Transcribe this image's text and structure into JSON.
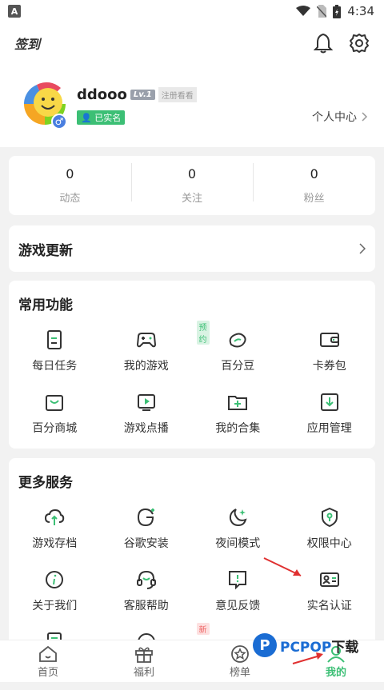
{
  "statusbar": {
    "app_badge": "A",
    "time": "4:34"
  },
  "topbar": {
    "signin_label": "签到"
  },
  "profile": {
    "username": "ddooo",
    "level": "Lv.1",
    "level_tag": "注册看看",
    "verified": "已实名",
    "center_link": "个人中心"
  },
  "stats": [
    {
      "value": "0",
      "label": "动态"
    },
    {
      "value": "0",
      "label": "关注"
    },
    {
      "value": "0",
      "label": "粉丝"
    }
  ],
  "game_update": {
    "title": "游戏更新"
  },
  "common": {
    "title": "常用功能",
    "items": [
      {
        "label": "每日任务",
        "icon": "task-icon"
      },
      {
        "label": "我的游戏",
        "icon": "gamepad-icon",
        "tag": "预约"
      },
      {
        "label": "百分豆",
        "icon": "bean-icon"
      },
      {
        "label": "卡券包",
        "icon": "wallet-icon"
      },
      {
        "label": "百分商城",
        "icon": "shop-icon"
      },
      {
        "label": "游戏点播",
        "icon": "play-icon"
      },
      {
        "label": "我的合集",
        "icon": "folder-plus-icon"
      },
      {
        "label": "应用管理",
        "icon": "download-box-icon"
      }
    ]
  },
  "more": {
    "title": "更多服务",
    "items": [
      {
        "label": "游戏存档",
        "icon": "cloud-upload-icon"
      },
      {
        "label": "谷歌安装",
        "icon": "google-icon"
      },
      {
        "label": "夜间模式",
        "icon": "moon-icon"
      },
      {
        "label": "权限中心",
        "icon": "shield-icon"
      },
      {
        "label": "关于我们",
        "icon": "info-icon"
      },
      {
        "label": "客服帮助",
        "icon": "headset-icon"
      },
      {
        "label": "意见反馈",
        "icon": "feedback-icon"
      },
      {
        "label": "实名认证",
        "icon": "id-card-icon"
      },
      {
        "label": "",
        "icon": "doc-icon"
      },
      {
        "label": "",
        "icon": "smile-icon",
        "tag": "新"
      }
    ]
  },
  "navbar": [
    {
      "label": "首页",
      "icon": "home-icon"
    },
    {
      "label": "福利",
      "icon": "gift-icon"
    },
    {
      "label": "榜单",
      "icon": "star-icon"
    },
    {
      "label": "我的",
      "icon": "user-icon",
      "active": true
    }
  ],
  "watermark": {
    "logo": "P",
    "brand": "PCPOP",
    "suffix": "下载"
  },
  "colors": {
    "accent": "#3cbf75",
    "annotation_arrow": "#e03030",
    "watermark": "#1a6cd3"
  }
}
